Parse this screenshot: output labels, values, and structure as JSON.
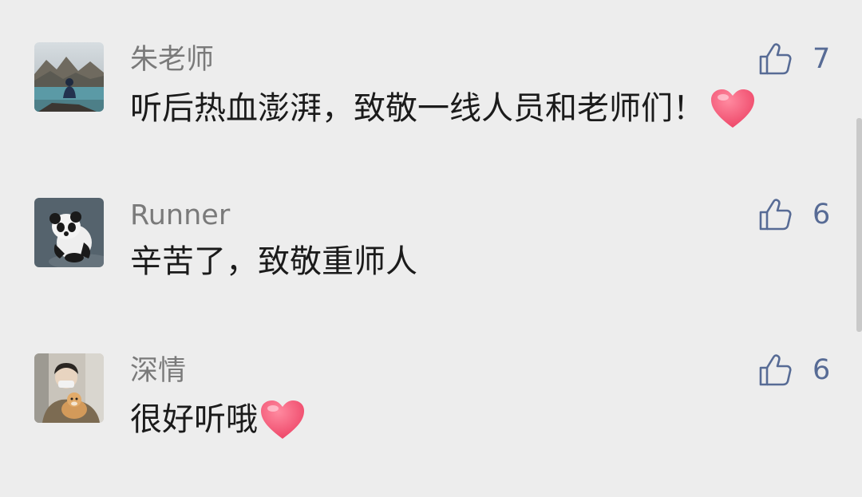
{
  "comments": [
    {
      "author": "朱老师",
      "text": "听后热血澎湃，致敬一线人员和老师们！",
      "likes": "7",
      "avatar": "lake-mountain-avatar",
      "emoji": "heart"
    },
    {
      "author": "Runner",
      "text": "辛苦了，致敬重师人",
      "likes": "6",
      "avatar": "panda-avatar",
      "emoji": ""
    },
    {
      "author": "深情",
      "text": "很好听哦",
      "likes": "6",
      "avatar": "person-with-dog-avatar",
      "emoji": "heart"
    }
  ],
  "colors": {
    "background": "#ededed",
    "author": "#7a7a7a",
    "text": "#1b1b1b",
    "like": "#576b95",
    "heart": "#f0506e"
  },
  "icons": {
    "like": "thumbs-up-icon",
    "emoji": "heart-icon"
  }
}
